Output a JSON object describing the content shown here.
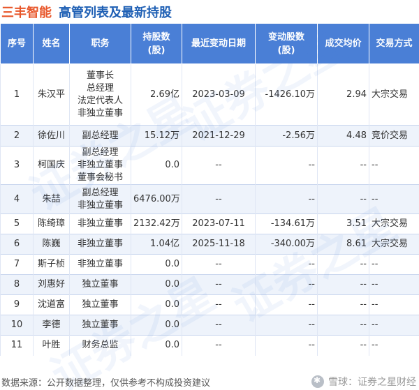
{
  "header": {
    "company": "三丰智能",
    "subtitle": "高管列表及最新持股"
  },
  "table": {
    "columns": [
      "序号",
      "姓名",
      "职务",
      "持股数\n(股)",
      "最近变动日期",
      "变动股数\n(股)",
      "成交均价",
      "交易方式"
    ],
    "rows": [
      {
        "no": "1",
        "name": "朱汉平",
        "roles": [
          "董事长",
          "总经理",
          "法定代表人",
          "非独立董事"
        ],
        "shares": "2.69亿",
        "date": "2023-03-09",
        "change": "-1426.10万",
        "price": "2.94",
        "method": "大宗交易"
      },
      {
        "no": "2",
        "name": "徐佐川",
        "roles": [
          "副总经理"
        ],
        "shares": "15.12万",
        "date": "2021-12-29",
        "change": "-2.56万",
        "price": "4.48",
        "method": "竞价交易"
      },
      {
        "no": "3",
        "name": "柯国庆",
        "roles": [
          "副总经理",
          "非独立董事",
          "董事会秘书"
        ],
        "shares": "0.0",
        "date": "--",
        "change": "--",
        "price": "--",
        "method": "--"
      },
      {
        "no": "4",
        "name": "朱喆",
        "roles": [
          "副总经理",
          "非独立董事"
        ],
        "shares": "6476.00万",
        "date": "--",
        "change": "--",
        "price": "--",
        "method": "--"
      },
      {
        "no": "5",
        "name": "陈绮璋",
        "roles": [
          "非独立董事"
        ],
        "shares": "2132.42万",
        "date": "2023-07-11",
        "change": "-134.61万",
        "price": "3.51",
        "method": "大宗交易"
      },
      {
        "no": "6",
        "name": "陈巍",
        "roles": [
          "非独立董事"
        ],
        "shares": "1.04亿",
        "date": "2025-11-18",
        "change": "-340.00万",
        "price": "8.61",
        "method": "大宗交易"
      },
      {
        "no": "7",
        "name": "斯子桢",
        "roles": [
          "非独立董事"
        ],
        "shares": "0.0",
        "date": "--",
        "change": "--",
        "price": "--",
        "method": "--"
      },
      {
        "no": "8",
        "name": "刘惠好",
        "roles": [
          "独立董事"
        ],
        "shares": "0.0",
        "date": "--",
        "change": "--",
        "price": "--",
        "method": "--"
      },
      {
        "no": "9",
        "name": "沈道富",
        "roles": [
          "独立董事"
        ],
        "shares": "0.0",
        "date": "--",
        "change": "--",
        "price": "--",
        "method": "--"
      },
      {
        "no": "10",
        "name": "李德",
        "roles": [
          "独立董事"
        ],
        "shares": "0.0",
        "date": "--",
        "change": "--",
        "price": "--",
        "method": "--"
      },
      {
        "no": "11",
        "name": "叶胜",
        "roles": [
          "财务总监"
        ],
        "shares": "0.0",
        "date": "--",
        "change": "--",
        "price": "--",
        "method": "--"
      }
    ]
  },
  "footer": {
    "source": "数据来源：公开数据整理，仅供参考不构成投资建议",
    "brand": "雪球：证券之星财经"
  },
  "watermark": {
    "text": "证券之星"
  },
  "colors": {
    "header_bg": "#4a7fd6",
    "company_title": "#e8562a",
    "subtitle": "#1e5fb4",
    "price_green": "#2c9a3b",
    "row_alt_bg": "#eef3fb"
  }
}
